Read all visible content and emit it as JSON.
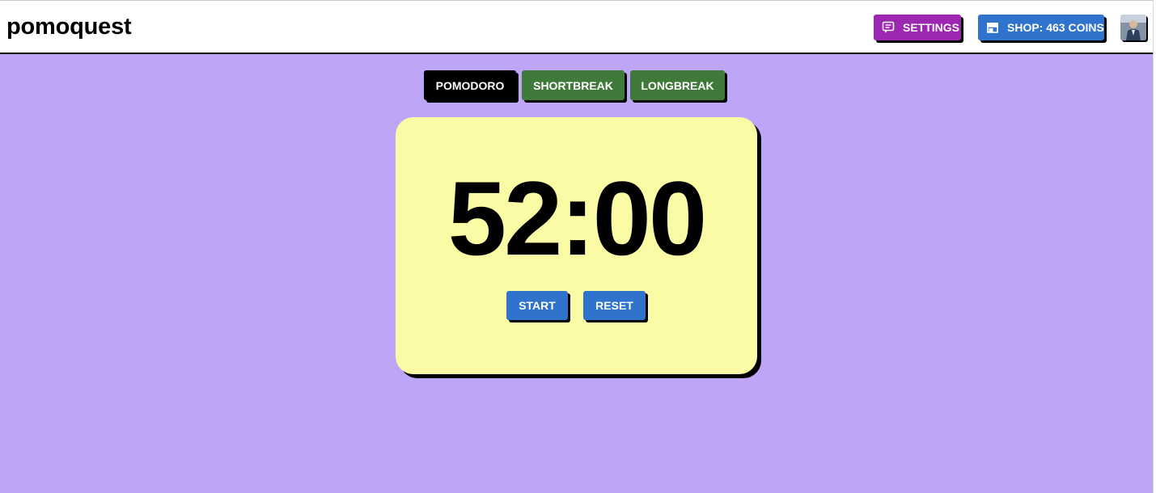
{
  "app": {
    "brand": "pomoquest"
  },
  "header": {
    "settings_label": "SETTINGS",
    "settings_icon": "message-icon",
    "shop_label": "SHOP: 463 COINS",
    "shop_icon": "store-icon",
    "avatar": "user-avatar"
  },
  "modes": [
    {
      "label": "POMODORO",
      "active": true
    },
    {
      "label": "SHORTBREAK",
      "active": false
    },
    {
      "label": "LONGBREAK",
      "active": false
    }
  ],
  "timer": {
    "display": "52:00"
  },
  "controls": {
    "start_label": "START",
    "reset_label": "RESET"
  },
  "colors": {
    "background": "#bea5f7",
    "card": "#fbfaa5",
    "settings": "#9c27b0",
    "primary": "#2f73cc",
    "mode_active": "#000000",
    "mode_inactive": "#3f7a3a"
  }
}
